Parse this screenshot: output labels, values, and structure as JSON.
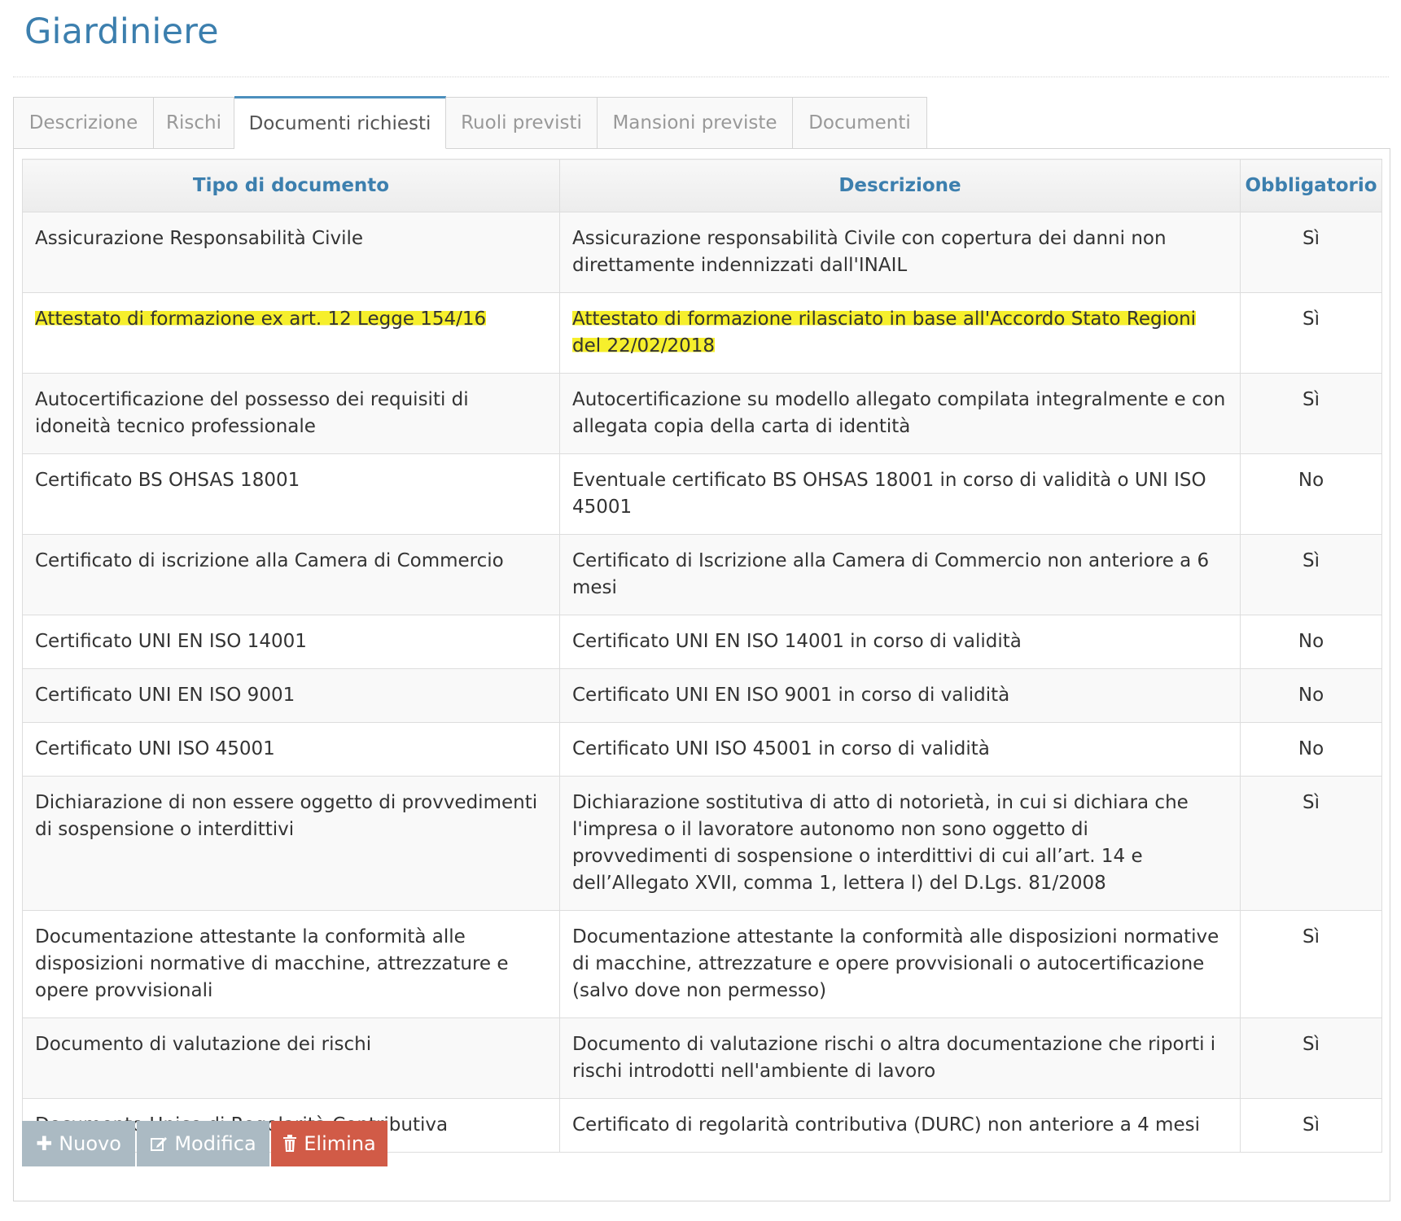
{
  "page": {
    "title": "Giardiniere"
  },
  "tabs": [
    {
      "label": "Descrizione",
      "active": false
    },
    {
      "label": "Rischi",
      "active": false
    },
    {
      "label": "Documenti richiesti",
      "active": true
    },
    {
      "label": "Ruoli previsti",
      "active": false
    },
    {
      "label": "Mansioni previste",
      "active": false
    },
    {
      "label": "Documenti",
      "active": false
    }
  ],
  "table": {
    "headers": {
      "tipo": "Tipo di documento",
      "descrizione": "Descrizione",
      "obbligatorio": "Obbligatorio"
    },
    "rows": [
      {
        "tipo": "Assicurazione Responsabilità Civile",
        "descrizione": "Assicurazione responsabilità Civile con copertura dei danni non direttamente indennizzati dall'INAIL",
        "obbligatorio": "Sì"
      },
      {
        "tipo": "Attestato di formazione ex art. 12 Legge 154/16",
        "descrizione": "Attestato di formazione rilasciato in base all'Accordo Stato Regioni del 22/02/2018",
        "obbligatorio": "Sì",
        "highlighted": true
      },
      {
        "tipo": "Autocertificazione del possesso dei requisiti di idoneità tecnico professionale",
        "descrizione": "Autocertificazione su modello allegato compilata integralmente e con allegata copia della carta di identità",
        "obbligatorio": "Sì"
      },
      {
        "tipo": "Certificato BS OHSAS 18001",
        "descrizione": "Eventuale certificato BS OHSAS 18001 in corso di validità o UNI ISO 45001",
        "obbligatorio": "No"
      },
      {
        "tipo": "Certificato di iscrizione alla Camera di Commercio",
        "descrizione": "Certificato di Iscrizione alla Camera di Commercio non anteriore a 6 mesi",
        "obbligatorio": "Sì"
      },
      {
        "tipo": "Certificato UNI EN ISO 14001",
        "descrizione": "Certificato UNI EN ISO 14001 in corso di validità",
        "obbligatorio": "No"
      },
      {
        "tipo": "Certificato UNI EN ISO 9001",
        "descrizione": "Certificato UNI EN ISO 9001 in corso di validità",
        "obbligatorio": "No"
      },
      {
        "tipo": "Certificato UNI ISO 45001",
        "descrizione": "Certificato UNI ISO 45001 in corso di validità",
        "obbligatorio": "No"
      },
      {
        "tipo": "Dichiarazione di non essere oggetto di provvedimenti di sospensione o interdittivi",
        "descrizione": "Dichiarazione sostitutiva di atto di notorietà, in cui si dichiara che l'impresa o il lavoratore autonomo non sono oggetto di provvedimenti di sospensione o interdittivi di cui all’art. 14 e dell’Allegato XVII, comma 1, lettera l) del D.Lgs. 81/2008",
        "obbligatorio": "Sì"
      },
      {
        "tipo": "Documentazione attestante la conformità alle disposizioni normative di macchine, attrezzature e opere provvisionali",
        "descrizione": "Documentazione attestante la conformità alle disposizioni normative di macchine, attrezzature e opere provvisionali o autocertificazione (salvo dove non permesso)",
        "obbligatorio": "Sì"
      },
      {
        "tipo": "Documento di valutazione dei rischi",
        "descrizione": "Documento di valutazione rischi o altra documentazione che riporti i rischi introdotti nell'ambiente di lavoro",
        "obbligatorio": "Sì"
      },
      {
        "tipo": "Documento Unico di Regolarità Contributiva",
        "descrizione": "Certificato di regolarità contributiva (DURC) non anteriore a 4 mesi",
        "obbligatorio": "Sì"
      }
    ]
  },
  "buttons": {
    "nuovo": "Nuovo",
    "modifica": "Modifica",
    "elimina": "Elimina"
  },
  "colors": {
    "title": "#3c7fae",
    "header_text": "#3c7fae",
    "highlight": "#f6ef2c",
    "btn_grey": "#abbac3",
    "btn_danger": "#d15b47"
  },
  "icons": {
    "nuovo": "plus-icon",
    "modifica": "edit-icon",
    "elimina": "trash-icon"
  }
}
